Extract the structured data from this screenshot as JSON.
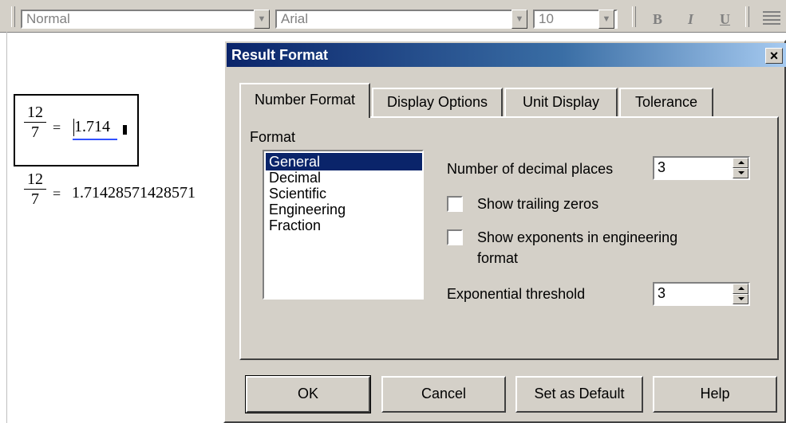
{
  "toolbar": {
    "style_value": "Normal",
    "font_value": "Arial",
    "size_value": "10",
    "bold": "B",
    "italic": "I",
    "underline": "U"
  },
  "worksheet": {
    "expr1": {
      "numerator": "12",
      "denominator": "7",
      "equals": "=",
      "result": "1.714"
    },
    "expr2": {
      "numerator": "12",
      "denominator": "7",
      "equals": "=",
      "result": "1.71428571428571"
    }
  },
  "dialog": {
    "title": "Result Format",
    "close": "×",
    "tabs": [
      {
        "label": "Number Format",
        "active": true
      },
      {
        "label": "Display Options",
        "active": false
      },
      {
        "label": "Unit Display",
        "active": false
      },
      {
        "label": "Tolerance",
        "active": false
      }
    ],
    "format_label": "Format",
    "format_options": [
      "General",
      "Decimal",
      "Scientific",
      "Engineering",
      "Fraction"
    ],
    "selected_format": "General",
    "decimal_places_label": "Number of decimal places",
    "decimal_places_value": "3",
    "show_trailing_zeros": {
      "label": "Show trailing zeros",
      "checked": false
    },
    "show_exponents": {
      "label_line1": "Show exponents in engineering",
      "label_line2": "format",
      "checked": false
    },
    "exp_threshold_label": "Exponential threshold",
    "exp_threshold_value": "3",
    "buttons": {
      "ok": "OK",
      "cancel": "Cancel",
      "set_default": "Set as Default",
      "help": "Help"
    }
  },
  "colors": {
    "dialog_bg": "#d4d0c8",
    "title_gradient_start": "#0a246a",
    "title_gradient_end": "#a6caf0",
    "selection": "#0a246a"
  }
}
